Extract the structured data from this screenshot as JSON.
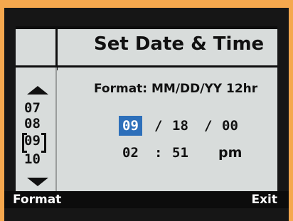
{
  "title": "Set Date & Time",
  "format_label": "Format: MM/DD/YY 12hr",
  "list": {
    "items": [
      "07",
      "08",
      "09",
      "10"
    ]
  },
  "date": {
    "month": "09",
    "sep1": "/",
    "day": "18",
    "sep2": "/",
    "year": "00"
  },
  "time": {
    "hour": "02",
    "sep": ":",
    "minute": "51",
    "ampm": "pm"
  },
  "softkeys": {
    "left": "Format",
    "right": "Exit"
  },
  "colors": {
    "highlight": "#2d6fba",
    "background": "#d8dcdb",
    "bezel": "#161616"
  }
}
